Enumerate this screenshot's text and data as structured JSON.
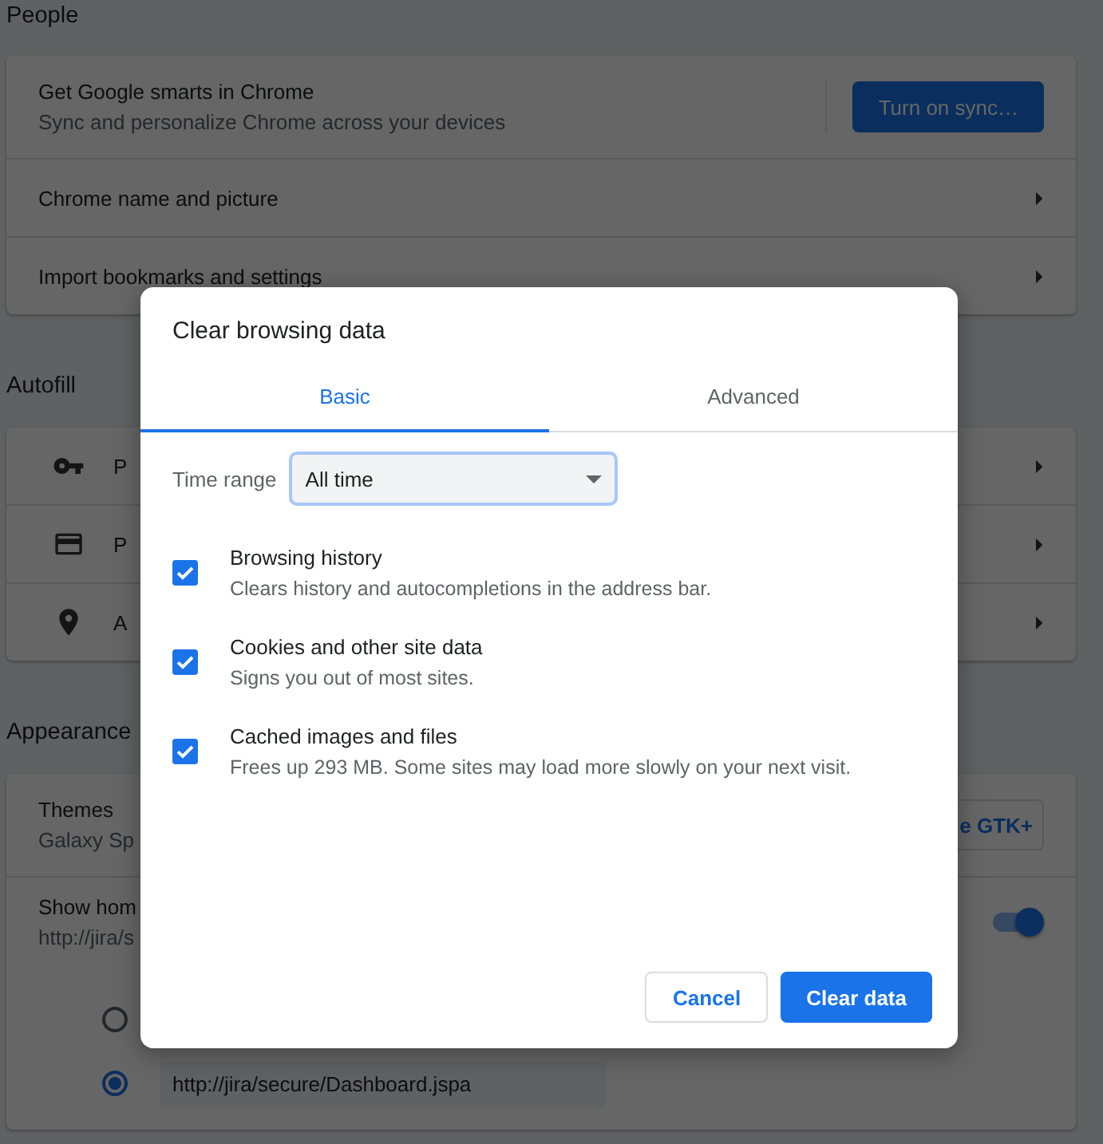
{
  "settings": {
    "sections": [
      {
        "kind": "people",
        "heading": "People",
        "sync": {
          "title": "Get Google smarts in Chrome",
          "subtitle": "Sync and personalize Chrome across your devices",
          "button": "Turn on sync…"
        },
        "rows": [
          {
            "label": "Chrome name and picture"
          },
          {
            "label": "Import bookmarks and settings"
          }
        ]
      },
      {
        "kind": "autofill",
        "heading": "Autofill",
        "rows": [
          {
            "label": "P"
          },
          {
            "label": "P"
          },
          {
            "label": "A"
          }
        ]
      },
      {
        "kind": "appearance",
        "heading": "Appearance",
        "themes": {
          "title": "Themes",
          "subtitle": "Galaxy Sp",
          "button": "e GTK+"
        },
        "home": {
          "title": "Show hom",
          "subtitle": "http://jira/s",
          "on": true
        },
        "options": [
          {
            "selected": false
          },
          {
            "value": "http://jira/secure/Dashboard.jspa",
            "selected": true
          }
        ]
      }
    ]
  },
  "dialog": {
    "title": "Clear browsing data",
    "tabs": [
      {
        "label": "Basic",
        "selected": true
      },
      {
        "label": "Advanced",
        "selected": false
      }
    ],
    "time_range": {
      "label": "Time range",
      "value": "All time"
    },
    "items": [
      {
        "title": "Browsing history",
        "description": "Clears history and autocompletions in the address bar.",
        "checked": true
      },
      {
        "title": "Cookies and other site data",
        "description": "Signs you out of most sites.",
        "checked": true
      },
      {
        "title": "Cached images and files",
        "description": "Frees up 293 MB. Some sites may load more slowly on your next visit.",
        "checked": true
      }
    ],
    "buttons": {
      "cancel": "Cancel",
      "confirm": "Clear data"
    }
  }
}
